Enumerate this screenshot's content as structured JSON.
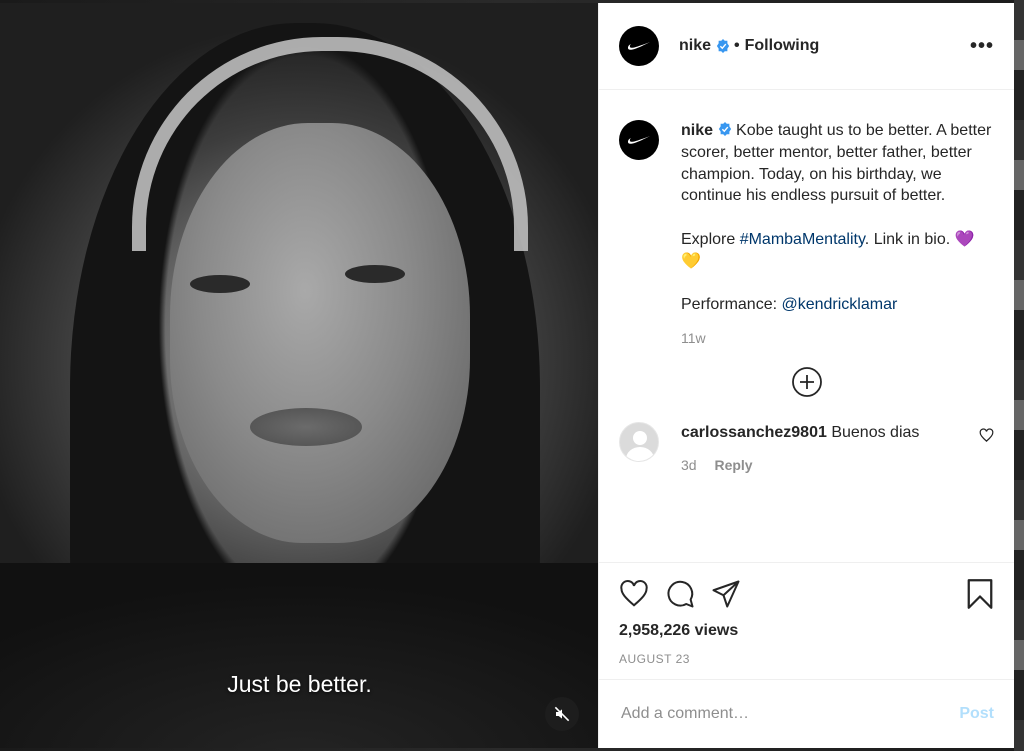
{
  "video": {
    "subtitle": "Just be better.",
    "mute_icon": "speaker-muted-icon"
  },
  "header": {
    "username": "nike",
    "separator": "•",
    "follow_status": "Following",
    "more_label": "•••"
  },
  "caption": {
    "username": "nike",
    "para1": "Kobe taught us to be better. A better scorer, better mentor, better father, better champion. Today, on his birthday, we continue his endless pursuit of better.",
    "explore_prefix": "Explore ",
    "hashtag": "#MambaMentality",
    "explore_suffix": ". Link in bio. 💜💛",
    "performance_prefix": "Performance: ",
    "mention": "@kendricklamar",
    "age": "11w"
  },
  "comment": {
    "username": "carlossanchez9801",
    "text": "Buenos dias",
    "age": "3d",
    "reply_label": "Reply"
  },
  "stats": {
    "views": "2,958,226 views",
    "date": "AUGUST 23"
  },
  "composer": {
    "placeholder": "Add a comment…",
    "post_label": "Post"
  },
  "colors": {
    "link": "#00376b",
    "verified": "#3897f0",
    "post_disabled": "#b2dffc"
  }
}
